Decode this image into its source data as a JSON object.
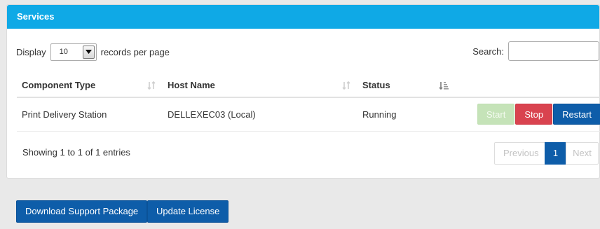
{
  "panel": {
    "title": "Services"
  },
  "length": {
    "prefix": "Display",
    "value": "10",
    "suffix": "records per page"
  },
  "search": {
    "label": "Search:",
    "value": "",
    "placeholder": ""
  },
  "table": {
    "headers": [
      "Component Type",
      "Host Name",
      "Status"
    ],
    "rows": [
      {
        "component": "Print Delivery Station",
        "host": "DELLEXEC03 (Local)",
        "status": "Running"
      }
    ]
  },
  "actions": {
    "start": "Start",
    "stop": "Stop",
    "restart": "Restart"
  },
  "info": "Showing 1 to 1 of 1 entries",
  "pagination": {
    "previous": "Previous",
    "current": "1",
    "next": "Next"
  },
  "footer": {
    "download": "Download Support Package",
    "license": "Update License"
  },
  "colors": {
    "header": "#0fa9e6",
    "primary": "#0e5da9",
    "danger": "#d9434f",
    "start_disabled": "#c5e3b8",
    "background": "#e9e9e9"
  },
  "icons": {
    "sort": "sort-both-icon",
    "sort_active": "sort-ascending-icon",
    "dropdown": "triangle-down-icon"
  }
}
